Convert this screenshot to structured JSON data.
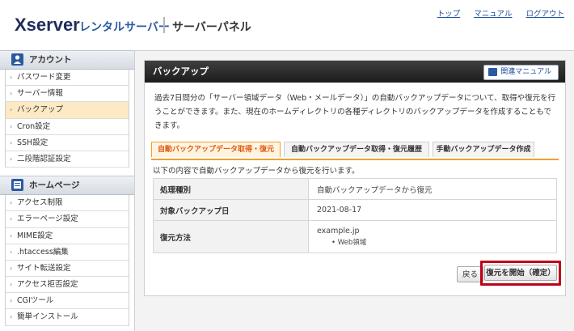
{
  "header": {
    "logo": "Xserver",
    "logo_sub": "レンタルサーバー",
    "panel_title": "サーバーパネル",
    "links": [
      "トップ",
      "マニュアル",
      "ログアウト"
    ]
  },
  "sidebar": {
    "sections": [
      {
        "title": "アカウント",
        "icon": "person-icon",
        "items": [
          "パスワード変更",
          "サーバー情報",
          "バックアップ",
          "Cron設定",
          "SSH設定",
          "二段階認証設定"
        ],
        "active": "バックアップ"
      },
      {
        "title": "ホームページ",
        "icon": "book-icon",
        "items": [
          "アクセス制限",
          "エラーページ設定",
          "MIME設定",
          ".htaccess編集",
          "サイト転送設定",
          "アクセス拒否設定",
          "CGIツール",
          "簡単インストール"
        ]
      }
    ]
  },
  "main": {
    "title": "バックアップ",
    "manual_button": "関連マニュアル",
    "description": "過去7日間分の「サーバー領域データ（Web・メールデータ）」の自動バックアップデータについて、取得や復元を行うことができます。また、現在のホームディレクトリの各種ディレクトリのバックアップデータを作成することもできます。",
    "tabs": [
      "自動バックアップデータ取得・復元",
      "自動バックアップデータ取得・復元履歴",
      "手動バックアップデータ作成"
    ],
    "active_tab": 0,
    "subtitle": "以下の内容で自動バックアップデータから復元を行います。",
    "rows": [
      {
        "label": "処理種別",
        "value": "自動バックアップデータから復元"
      },
      {
        "label": "対象バックアップ日",
        "value": "2021-08-17"
      },
      {
        "label": "復元方法",
        "value": "example.jp",
        "sub": "Web領域"
      }
    ],
    "back_button": "戻る",
    "confirm_button": "復元を開始（確定）"
  },
  "colors": {
    "accent": "#f0a030",
    "active_tab_text": "#e05a10",
    "highlight": "#c00018",
    "link": "#1a4f9c"
  }
}
